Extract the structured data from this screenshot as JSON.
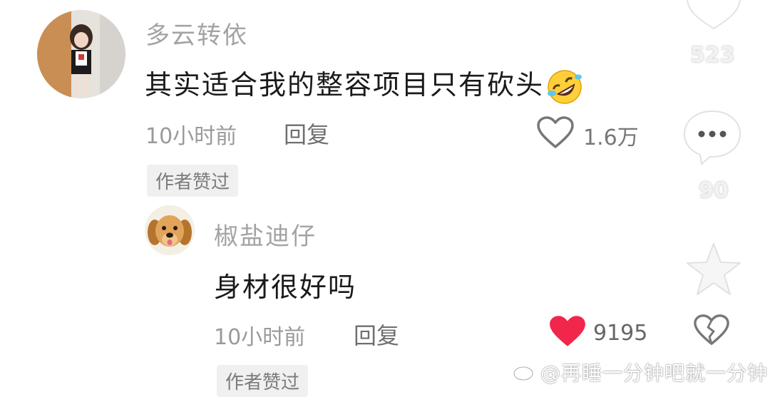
{
  "comments": [
    {
      "username": "多云转依",
      "text": "其实适合我的整容项目只有砍头",
      "emoji": "rolling-on-floor-laughing-emoji",
      "time": "10小时前",
      "reply_label": "回复",
      "like_count": "1.6万",
      "liked": false,
      "badge": "作者赞过"
    },
    {
      "username": "椒盐迪仔",
      "text": "身材很好吗",
      "time": "10小时前",
      "reply_label": "回复",
      "like_count": "9195",
      "liked": true,
      "badge": "作者赞过"
    }
  ],
  "side_rail": {
    "like_count": "523",
    "comment_count": "90"
  },
  "colors": {
    "liked_heart": "#f0264a",
    "username": "#a3a3a3",
    "badge_bg": "#f0f0f0"
  },
  "watermark": "@再睡一分钟吧就一分钟"
}
